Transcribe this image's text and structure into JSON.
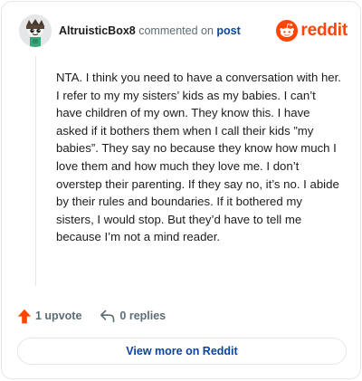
{
  "header": {
    "author": "AltruisticBox8",
    "action_text": "commented on",
    "post_link": "post",
    "brand": "reddit"
  },
  "comment": {
    "body": "NTA. I think you need to have a conversation with her. I refer to my my sisters’ kids as my babies. I can’t have children of my own. They know this. I have asked if it bothers them when I call their kids ”my babies”. They say no because they know how much I love them and how much they love me. I don’t overstep their parenting. If they say no, it’s no. I abide by their rules and boundaries. If it bothered my sisters, I would stop. But they’d have to tell me because I’m not a mind reader."
  },
  "actions": {
    "upvotes": "1 upvote",
    "replies": "0 replies"
  },
  "footer": {
    "view_more": "View more on Reddit"
  },
  "colors": {
    "brand": "#ff4500",
    "link": "#0a449b",
    "muted": "#5c6c74",
    "border": "#e5e7e8"
  },
  "icons": {
    "avatar": "snoo-avatar",
    "brand": "reddit-logo-icon",
    "upvote": "upvote-arrow-icon",
    "reply": "reply-arrow-icon"
  }
}
